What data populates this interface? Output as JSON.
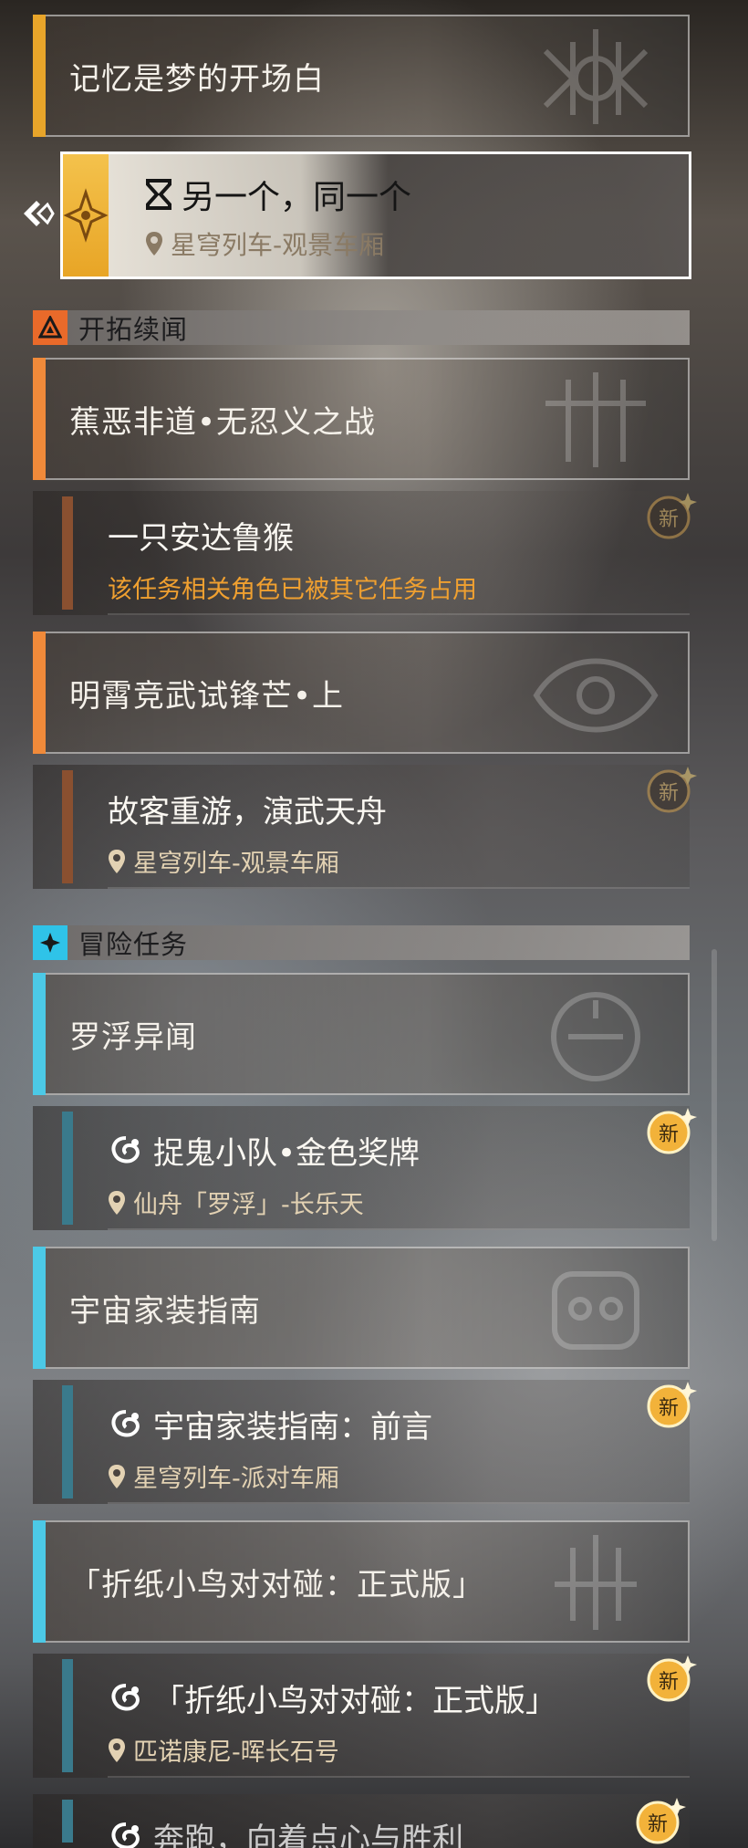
{
  "top_chapter": {
    "title": "记忆是梦的开场白",
    "accent": "#e8a52a"
  },
  "selected_quest": {
    "title": "另一个，同一个",
    "location": "星穹列车-观景车厢"
  },
  "sections": [
    {
      "label": "开拓续闻",
      "accent": "#e96a2a"
    },
    {
      "label": "冒险任务",
      "accent": "#2fc3e8"
    }
  ],
  "chapters": [
    {
      "title": "蕉恶非道•无忍义之战",
      "accent": "#f08a3a"
    },
    {
      "title": "明霄竞武试锋芒•上",
      "accent": "#f08a3a"
    },
    {
      "title": "罗浮异闻",
      "accent": "#4cc9e6"
    },
    {
      "title": "宇宙家装指南",
      "accent": "#4cc9e6"
    },
    {
      "title": "「折纸小鸟对对碰：正式版」",
      "accent": "#4cc9e6"
    }
  ],
  "quests": [
    {
      "title": "一只安达鲁猴",
      "subtitle": "该任务相关角色已被其它任务占用",
      "new_label": "新"
    },
    {
      "title": "故客重游，演武天舟",
      "subtitle": "星穹列车-观景车厢",
      "new_label": "新"
    },
    {
      "title": "捉鬼小队•金色奖牌",
      "subtitle": "仙舟「罗浮」-长乐天",
      "new_label": "新"
    },
    {
      "title": "宇宙家装指南：前言",
      "subtitle": "星穹列车-派对车厢",
      "new_label": "新"
    },
    {
      "title": "「折纸小鸟对对碰：正式版」",
      "subtitle": "匹诺康尼-晖长石号",
      "new_label": "新"
    },
    {
      "title": "奔跑，向着点心与胜利",
      "subtitle": "",
      "new_label": "新"
    }
  ],
  "colors": {
    "warn_text": "#f0a030",
    "new_badge": "#f2b23a",
    "quest_bar_orange": "#8a5030",
    "quest_bar_blue": "#3a7a8c"
  },
  "icons": [
    "hourglass-icon",
    "location-pin-icon",
    "new-badge-icon",
    "trailblaze-icon",
    "adventure-icon",
    "quest-swirl-icon",
    "selected-arrow-icon"
  ]
}
